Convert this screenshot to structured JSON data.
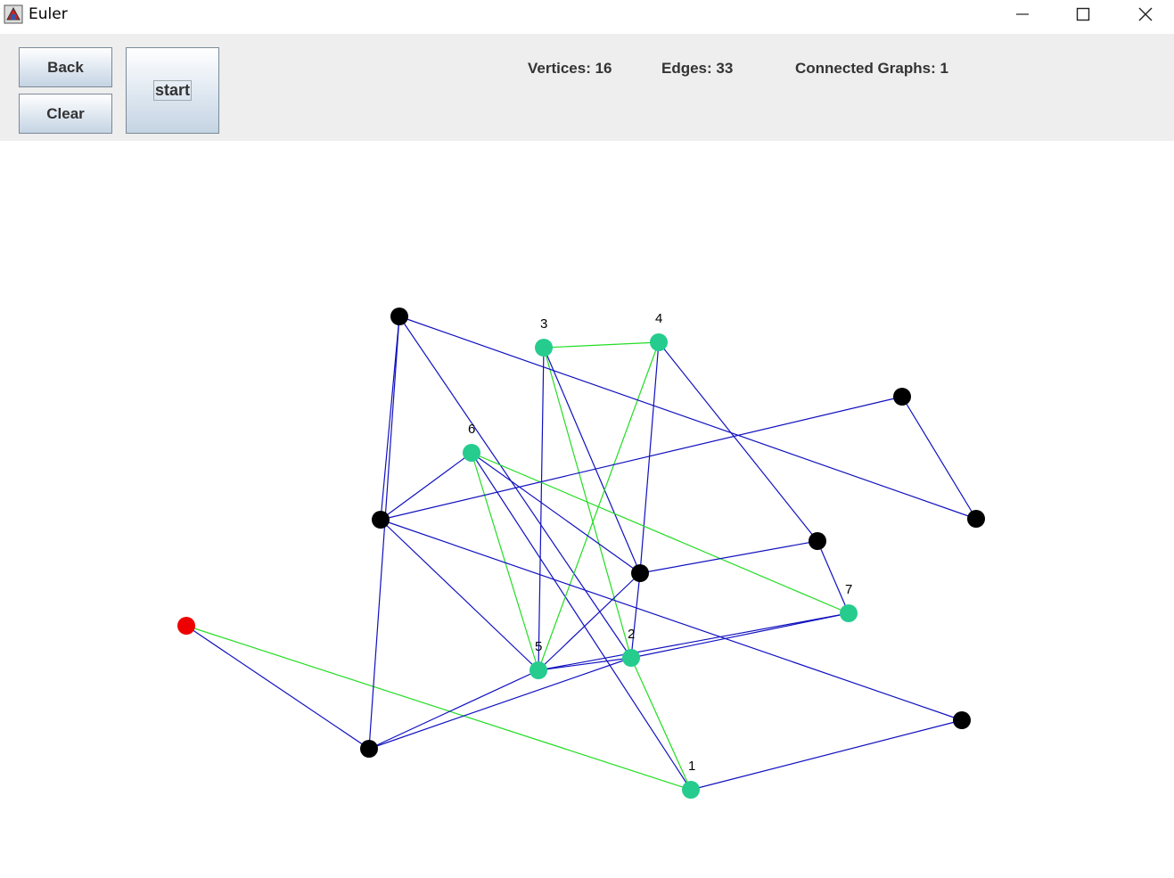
{
  "window": {
    "title": "Euler",
    "minimize_icon": "minimize-icon",
    "maximize_icon": "maximize-icon",
    "close_icon": "close-icon"
  },
  "toolbar": {
    "back_label": "Back",
    "clear_label": "Clear",
    "start_label": "start"
  },
  "stats": {
    "vertices": "Vertices: 16",
    "edges": "Edges: 33",
    "connected_graphs": "Connected Graphs: 1"
  },
  "colors": {
    "path_edge": "#22dd22",
    "edge": "#1010c0",
    "visited_vertex": "#25cc8e",
    "vertex": "#000000",
    "current_vertex": "#ee0000"
  },
  "graph": {
    "labels": {
      "v1": "1",
      "v2": "2",
      "v3": "3",
      "v4": "4",
      "v5": "5",
      "v6": "6",
      "v7": "7"
    },
    "vertices": [
      {
        "id": "v1",
        "state": "visited"
      },
      {
        "id": "v2",
        "state": "visited"
      },
      {
        "id": "v3",
        "state": "visited"
      },
      {
        "id": "v4",
        "state": "visited"
      },
      {
        "id": "v5",
        "state": "visited"
      },
      {
        "id": "v6",
        "state": "visited"
      },
      {
        "id": "v7",
        "state": "visited"
      },
      {
        "id": "red",
        "state": "current"
      },
      {
        "id": "A",
        "state": "unvisited"
      },
      {
        "id": "B",
        "state": "unvisited"
      },
      {
        "id": "C",
        "state": "unvisited"
      },
      {
        "id": "D",
        "state": "unvisited"
      },
      {
        "id": "E",
        "state": "unvisited"
      },
      {
        "id": "F",
        "state": "unvisited"
      },
      {
        "id": "G",
        "state": "unvisited"
      },
      {
        "id": "H",
        "state": "unvisited"
      }
    ],
    "edges": [
      [
        "red",
        "D",
        "normal"
      ],
      [
        "red",
        "v1",
        "path"
      ],
      [
        "v1",
        "v2",
        "path"
      ],
      [
        "v1",
        "v6",
        "normal"
      ],
      [
        "v1",
        "H",
        "normal"
      ],
      [
        "v2",
        "v3",
        "path"
      ],
      [
        "v2",
        "E",
        "normal"
      ],
      [
        "v2",
        "v7",
        "normal"
      ],
      [
        "v2",
        "D",
        "normal"
      ],
      [
        "v2",
        "v5",
        "normal"
      ],
      [
        "v2",
        "A",
        "normal"
      ],
      [
        "v3",
        "v4",
        "path"
      ],
      [
        "v3",
        "v5",
        "normal"
      ],
      [
        "v3",
        "E",
        "normal"
      ],
      [
        "v4",
        "v5",
        "path"
      ],
      [
        "v4",
        "E",
        "normal"
      ],
      [
        "v4",
        "F",
        "normal"
      ],
      [
        "v5",
        "v6",
        "path"
      ],
      [
        "v5",
        "v7",
        "normal"
      ],
      [
        "v5",
        "E",
        "normal"
      ],
      [
        "v5",
        "C",
        "normal"
      ],
      [
        "v5",
        "D",
        "normal"
      ],
      [
        "v6",
        "v7",
        "path"
      ],
      [
        "v6",
        "E",
        "normal"
      ],
      [
        "v6",
        "C",
        "normal"
      ],
      [
        "v7",
        "F",
        "normal"
      ],
      [
        "A",
        "C",
        "normal"
      ],
      [
        "A",
        "D",
        "normal"
      ],
      [
        "A",
        "G",
        "normal"
      ],
      [
        "B",
        "G",
        "normal"
      ],
      [
        "C",
        "B",
        "normal"
      ],
      [
        "C",
        "H",
        "normal"
      ],
      [
        "E",
        "F",
        "normal"
      ]
    ]
  }
}
